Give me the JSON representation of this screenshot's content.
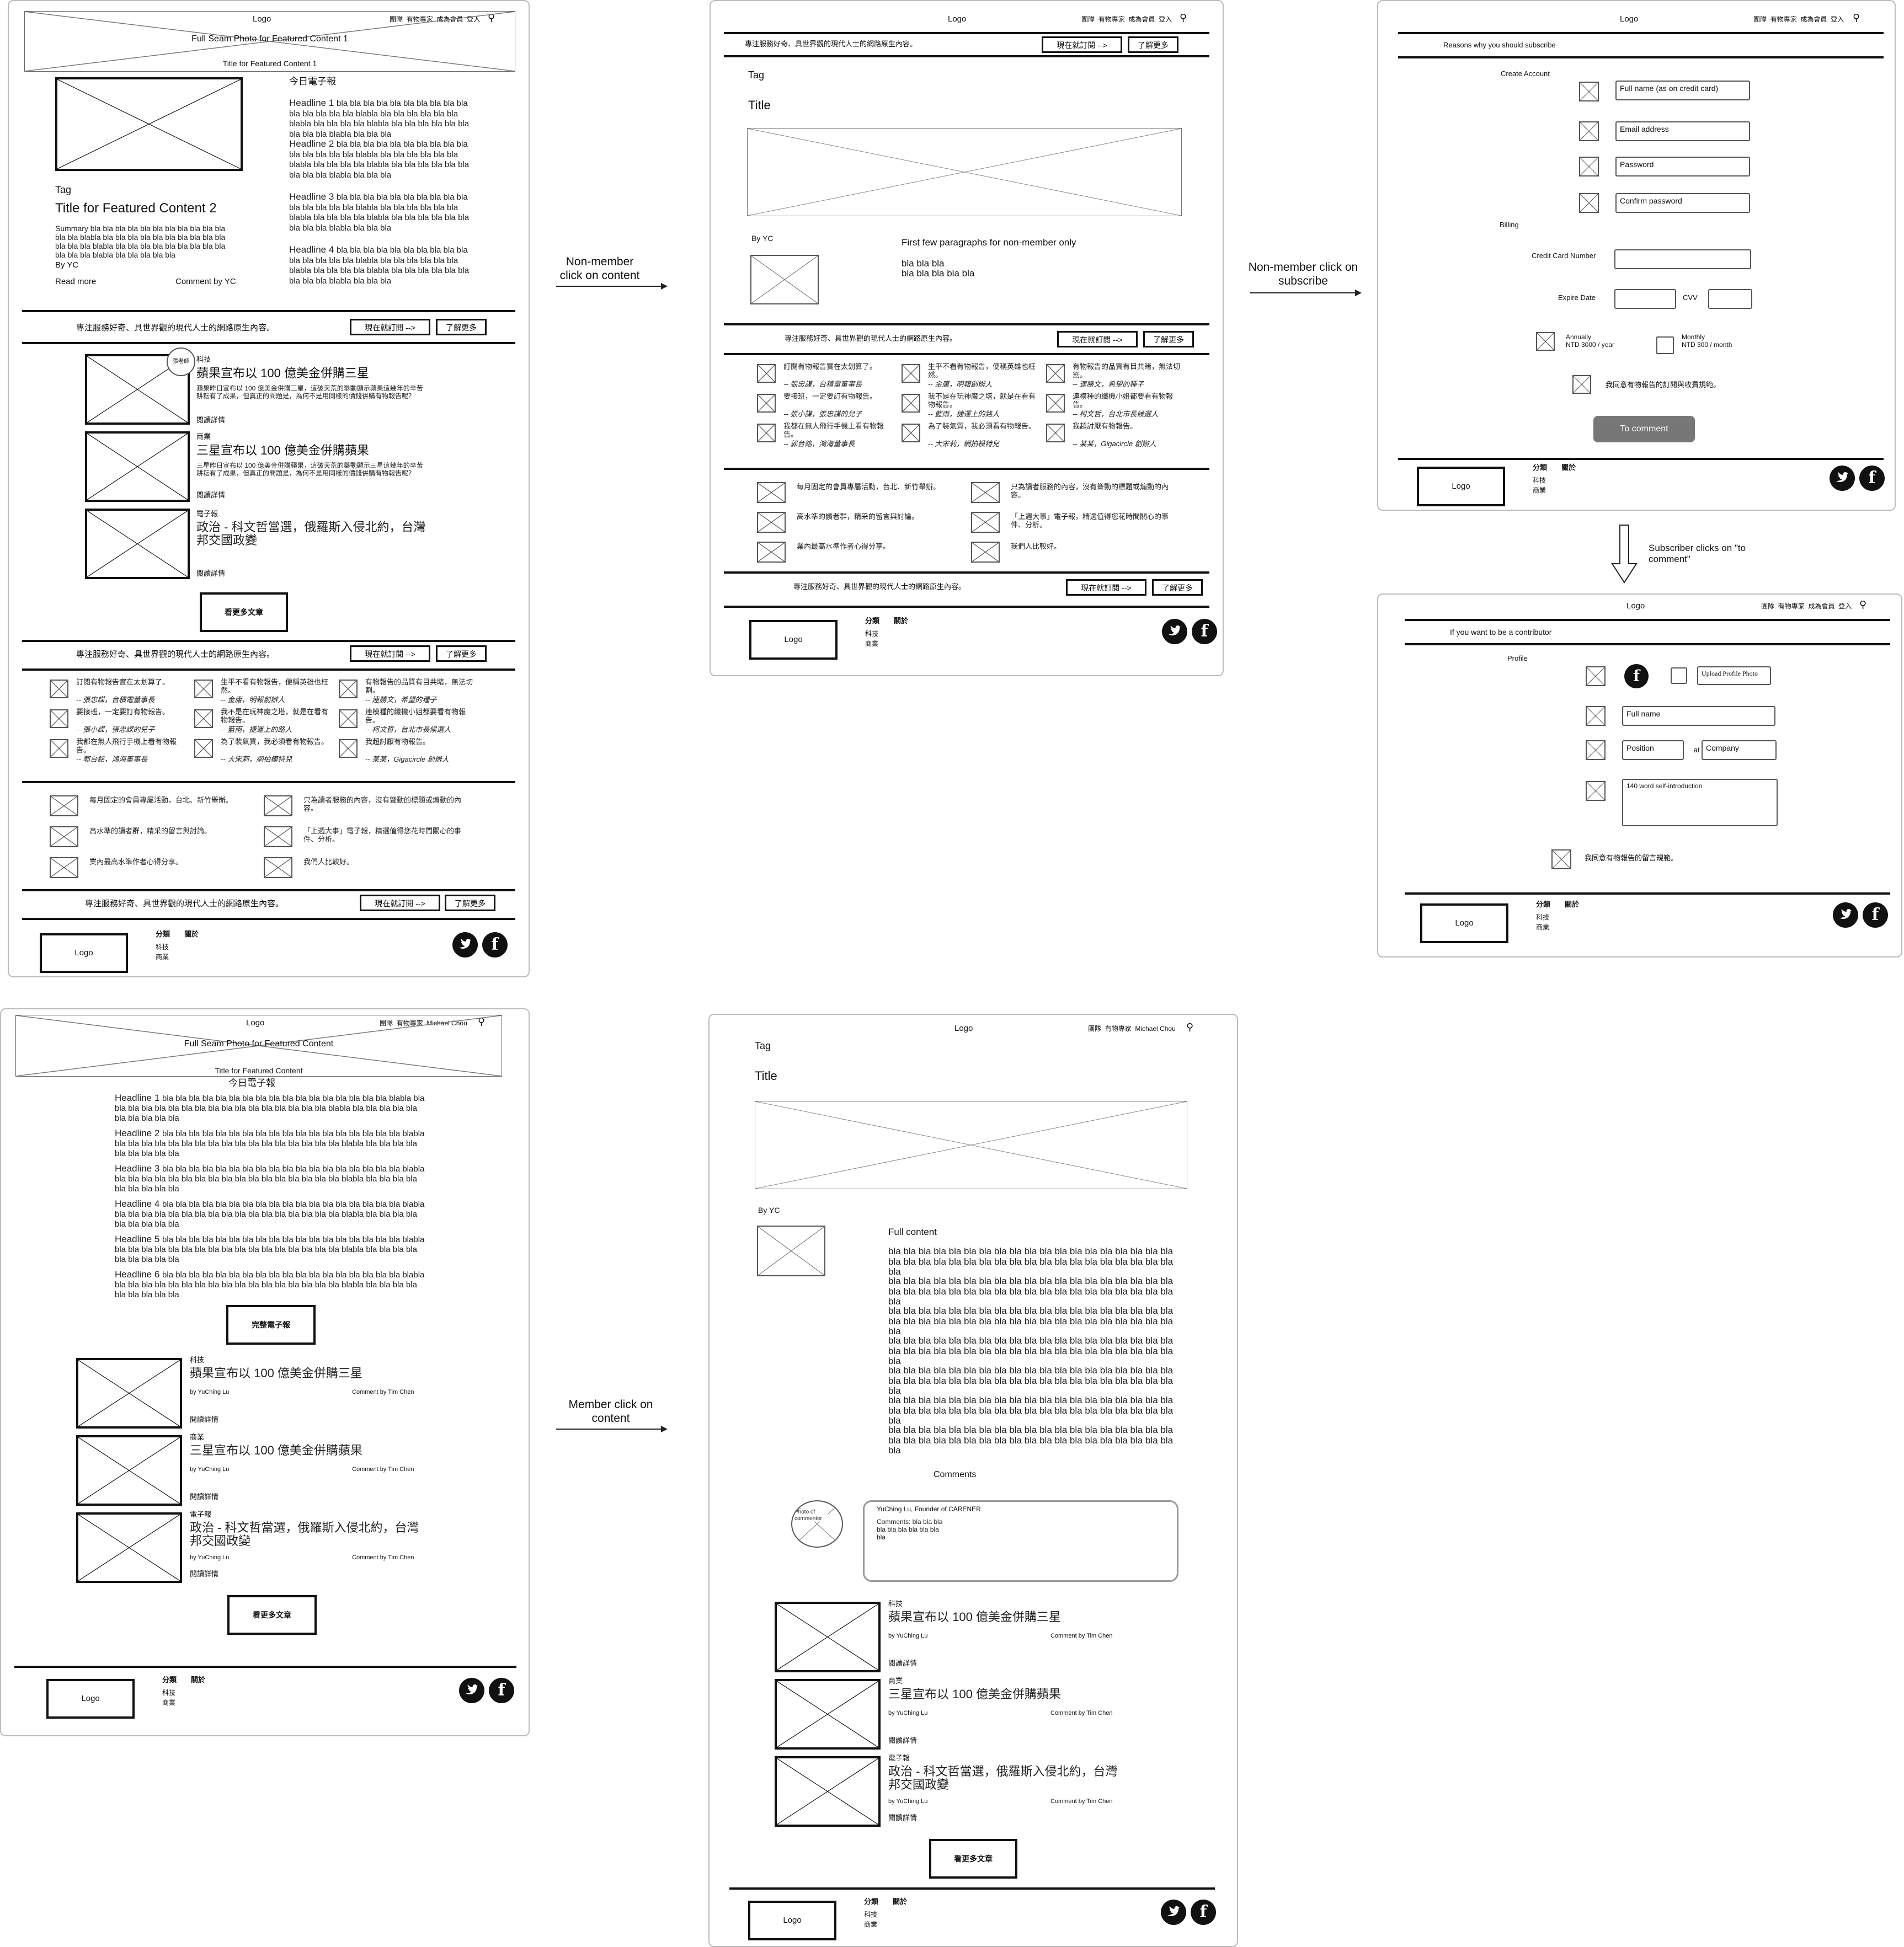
{
  "flow_labels": {
    "nonmember_content": "Non-member click on content",
    "nonmember_subscribe": "Non-member click on subscribe",
    "subscriber_comment": "Subscriber clicks on \"to comment\"",
    "member_content": "Member click on content"
  },
  "nav": {
    "logo": "Logo",
    "items": [
      "團隊",
      "有物專家",
      "成為會員",
      "登入"
    ],
    "member_name": "Michael Chou"
  },
  "home": {
    "hero_photo": "Full Seam Photo for Featured Content 1",
    "hero_title": "Title for Featured Content 1",
    "tag": "Tag",
    "feature_title": "Title for Featured Content 2",
    "feature_summary": "Summary bla bla bla bla bla bla bla bla bla bla bla bla bla blabla bla bla bla bla bla bla bla bla bla bla bla bla bla blabla bla bla bla bla bla bla bla bla bla bla bla bla blabla bla bla bla bla bla",
    "by": "By YC",
    "read_more": "Read more",
    "comment_by": "Comment by YC",
    "newsletter_title": "今日電子報",
    "headlines": [
      {
        "label": "Headline 1",
        "text": "bla bla bla bla bla bla bla bla bla bla bla bla bla bla bla blabla bla bla bla bla bla bla blabla bla bla bla bla blabla bla bla bla bla bla bla bla bla bla blabla bla bla bla"
      },
      {
        "label": "Headline 2",
        "text": "bla bla bla bla bla bla bla bla bla bla bla bla bla bla bla blabla bla bla bla bla bla bla blabla bla bla bla bla blabla bla bla bla bla bla bla bla bla bla blabla bla bla bla"
      },
      {
        "label": "Headline 3",
        "text": "bla bla bla bla bla bla bla bla bla bla bla bla bla bla bla blabla bla bla bla bla bla bla blabla bla bla bla bla blabla bla bla bla bla bla bla bla bla bla blabla bla bla bla"
      },
      {
        "label": "Headline 4",
        "text": "bla bla bla bla bla bla bla bla bla bla bla bla bla bla bla blabla bla bla bla bla bla bla blabla bla bla bla bla blabla bla bla bla bla bla bla bla bla bla blabla bla bla bla"
      }
    ],
    "more_articles": "看更多文章",
    "avatar_label": "張老師"
  },
  "cta": {
    "text": "專注服務好奇、具世界觀的現代人士的網路原生內容。",
    "subscribe": "現在就訂閱 -->",
    "learn": "了解更多"
  },
  "articles": [
    {
      "tag": "科技",
      "title": "蘋果宣布以 100 億美金併購三星",
      "summary": "蘋果昨日宣布以 100 億美金併購三星，這破天荒的舉動顯示蘋果這幾年的辛苦耕耘有了成果，但真正的問題是，為何不是用同樣的價錢併購有物報告呢？",
      "read": "閱讀詳情",
      "author": "by YuChing Lu",
      "comment": "Comment by Tim Chen"
    },
    {
      "tag": "商業",
      "title": "三星宣布以 100 億美金併購蘋果",
      "summary": "三星昨日宣布以 100 億美金併購蘋果，這破天荒的舉動顯示三星這幾年的辛苦耕耘有了成果，但真正的問題是，為何不是用同樣的價錢併購有物報告呢？",
      "read": "閱讀詳情",
      "author": "by YuChing Lu",
      "comment": "Comment by Tim Chen"
    },
    {
      "tag": "電子報",
      "title": "政治 - 科文哲當選，俄羅斯入侵北約，台灣邦交國政變",
      "summary": "",
      "read": "閱讀詳情",
      "author": "by YuChing Lu",
      "comment": "Comment by Tim Chen"
    }
  ],
  "testimonials": [
    {
      "quote": "訂閱有物報告實在太划算了。",
      "author": "-- 張忠謀，台積電董事長"
    },
    {
      "quote": "生平不看有物報告，便稱英雄也枉然。",
      "author": "-- 金庸，明報創辦人"
    },
    {
      "quote": "有物報告的品質有目共睹，無法切割。",
      "author": "-- 連勝文，希望的種子"
    },
    {
      "quote": "要接班，一定要訂有物報告。",
      "author": "-- 張小謀，張忠謀的兒子"
    },
    {
      "quote": "我不是在玩神魔之塔，就是在看有物報告。",
      "author": "-- 藍雨，捷運上的路人"
    },
    {
      "quote": "連模種的纖機小姐都要看有物報告。",
      "author": "-- 柯文哲，台北市長候選人"
    },
    {
      "quote": "我都在無人飛行手機上看有物報告。",
      "author": "-- 郭台銘，鴻海董事長"
    },
    {
      "quote": "為了裝氣質，我必須看有物報告。",
      "author": "-- 大宋莉，網拍模特兒"
    },
    {
      "quote": "我超討厭有物報告。",
      "author": "-- 某某，Gigacircle 創辦人"
    }
  ],
  "benefits": [
    "每月固定的會員專屬活動，台北、新竹舉辦。",
    "只為讀者服務的內容，沒有聳動的標題或煽動的內容。",
    "高水準的讀者群，精采的留言與討論。",
    "「上週大事」電子報，精選值得您花時間關心的事件、分析。",
    "業內最高水準作者心得分享。",
    "我們人比較好。"
  ],
  "footer": {
    "logo": "Logo",
    "categories": "分類",
    "about": "關於",
    "cat1": "科技",
    "cat2": "商業"
  },
  "article_page": {
    "tag": "Tag",
    "title": "Title",
    "by": "By YC",
    "preview_title": "First few paragraphs for non-member only",
    "preview_line1": "bla bla bla",
    "preview_line2": "bla bla bla bla bla",
    "full_title": "Full content",
    "full_paragraph": "bla bla bla bla bla bla bla bla bla bla bla bla bla bla bla bla bla bla bla bla bla bla bla bla bla bla bla bla bla bla bla bla bla bla bla bla bla bla bla",
    "comments_title": "Comments",
    "commenter_photo": "Photo of commenter",
    "commenter": "YuChing Lu, Founder of CARENER",
    "comment_text": "Comments: bla bla bla bla bla bla bla bla bla bla"
  },
  "subscribe": {
    "reasons": "Reasons why you should subscribe",
    "create_account": "Create Account",
    "full_name": "Full name (as on credit card)",
    "email": "Email address",
    "password": "Password",
    "confirm": "Confirm password",
    "billing": "Billing",
    "card": "Credit Card Number",
    "expire": "Expire Date",
    "cvv": "CVV",
    "annual": "Annually",
    "annual_price": "NTD 3000 / year",
    "monthly": "Monthly",
    "monthly_price": "NTD 300 / month",
    "agree": "我同意有物報告的訂閱與收費規範。",
    "to_comment": "To comment"
  },
  "contributor": {
    "title": "If you want to be a contributor",
    "profile": "Profile",
    "upload": "Upload Profile Photo",
    "full_name": "Full name",
    "position": "Position",
    "at": "at",
    "company": "Company",
    "intro": "140 word self-introduction",
    "agree": "我同意有物報告的留言規範。"
  },
  "member_home": {
    "hero_photo": "Full Seam Photo for Featured Content",
    "hero_title": "Title for Featured Content",
    "newsletter_title": "今日電子報",
    "headlines": [
      {
        "label": "Headline 1",
        "text": "bla bla bla bla bla bla bla bla bla bla bla bla bla bla bla bla bla blabla bla bla bla bla bla bla bla bla bla bla bla bla bla bla bla bla bla blabla bla bla bla bla bla bla bla bla bla bla"
      },
      {
        "label": "Headline 2",
        "text": "bla bla bla bla bla bla bla bla bla bla bla bla bla bla bla bla bla bla blabla bla bla bla bla bla bla bla bla bla bla bla bla bla bla bla bla bla blabla bla bla bla bla bla bla bla bla bla"
      },
      {
        "label": "Headline 3",
        "text": "bla bla bla bla bla bla bla bla bla bla bla bla bla bla bla bla bla bla blabla bla bla bla bla bla bla bla bla bla bla bla bla bla bla bla bla bla blabla bla bla bla bla bla bla bla bla bla"
      },
      {
        "label": "Headline 4",
        "text": "bla bla bla bla bla bla bla bla bla bla bla bla bla bla bla bla bla bla blabla bla bla bla bla bla bla bla bla bla bla bla bla bla bla bla bla bla blabla bla bla bla bla bla bla bla bla bla"
      },
      {
        "label": "Headline 5",
        "text": "bla bla bla bla bla bla bla bla bla bla bla bla bla bla bla bla bla bla blabla bla bla bla bla bla bla bla bla bla bla bla bla bla bla bla bla bla blabla bla bla bla bla bla bla bla bla bla"
      },
      {
        "label": "Headline 6",
        "text": "bla bla bla bla bla bla bla bla bla bla bla bla bla bla bla bla bla bla blabla bla bla bla bla bla bla bla bla bla bla bla bla bla bla bla bla bla blabla bla bla bla bla bla bla bla bla bla"
      }
    ],
    "full_newsletter": "完整電子報",
    "more_articles": "看更多文章"
  }
}
